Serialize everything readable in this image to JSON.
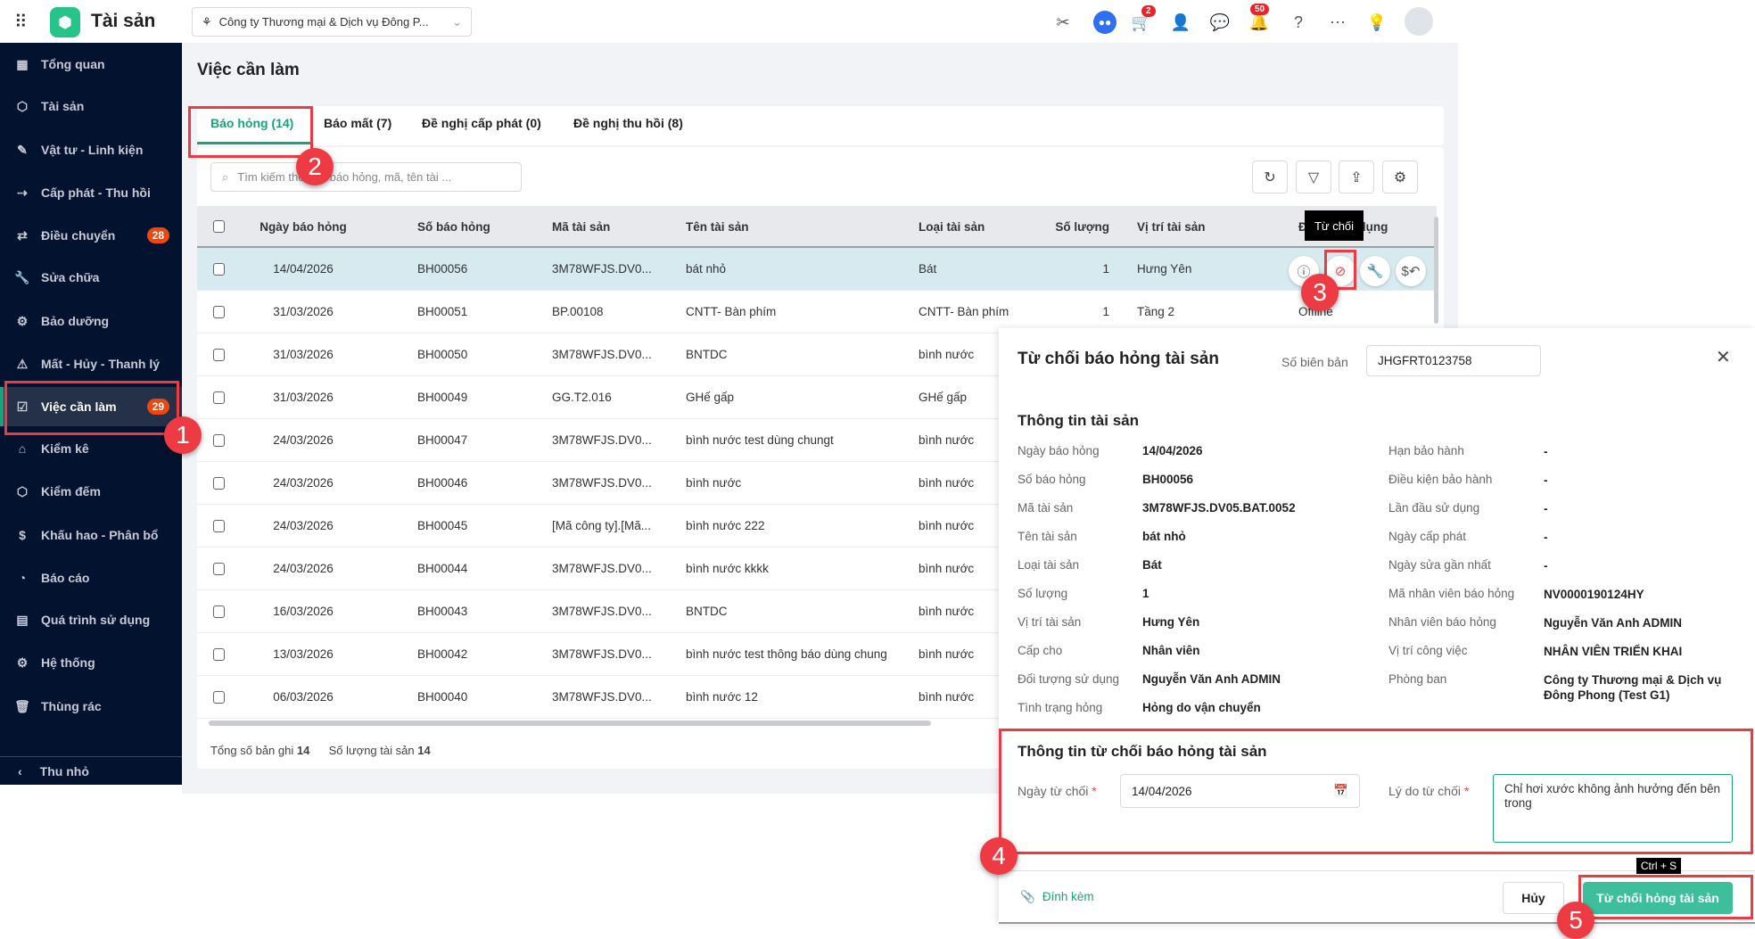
{
  "header": {
    "app_title": "Tài sản",
    "company_select": "Công ty Thương mại & Dịch vụ Đông P...",
    "cart_badge": "2",
    "notification_badge": "50"
  },
  "sidebar": {
    "items": [
      {
        "label": "Tổng quan",
        "icon": "grid-icon"
      },
      {
        "label": "Tài sản",
        "icon": "box-icon"
      },
      {
        "label": "Vật tư - Linh kiện",
        "icon": "pen-icon"
      },
      {
        "label": "Cấp phát - Thu hồi",
        "icon": "user-transfer-icon"
      },
      {
        "label": "Điều chuyển",
        "icon": "swap-icon",
        "badge": "28"
      },
      {
        "label": "Sửa chữa",
        "icon": "wrench-icon"
      },
      {
        "label": "Bảo dưỡng",
        "icon": "maintenance-icon"
      },
      {
        "label": "Mất - Hủy - Thanh lý",
        "icon": "warning-icon"
      },
      {
        "label": "Việc cần làm",
        "icon": "checkbox-icon",
        "badge": "29"
      },
      {
        "label": "Kiểm kê",
        "icon": "inbox-icon"
      },
      {
        "label": "Kiểm đếm",
        "icon": "box-icon"
      },
      {
        "label": "Khấu hao - Phân bổ",
        "icon": "dollar-icon"
      },
      {
        "label": "Báo cáo",
        "icon": "pie-icon"
      },
      {
        "label": "Quá trình sử dụng",
        "icon": "document-icon"
      },
      {
        "label": "Hệ thống",
        "icon": "gear-icon"
      },
      {
        "label": "Thùng rác",
        "icon": "trash-icon"
      }
    ],
    "collapse_label": "Thu nhỏ"
  },
  "main": {
    "page_title": "Việc cần làm",
    "tabs": [
      "Báo hỏng (14)",
      "Báo mất (7)",
      "Đề nghị cấp phát (0)",
      "Đề nghị thu hồi (8)"
    ],
    "search_placeholder": "Tìm kiếm theo số báo hỏng, mã, tên tài ...",
    "columns": [
      "Ngày báo hỏng",
      "Số báo hỏng",
      "Mã tài sản",
      "Tên tài sản",
      "Loại tài sản",
      "Số lượng",
      "Vị trí tài sản",
      "Đơn vị sử dụng"
    ],
    "rows": [
      [
        "14/04/2026",
        "BH00056",
        "3M78WFJS.DV0...",
        "bát nhỏ",
        "Bát",
        "1",
        "Hưng Yên",
        ""
      ],
      [
        "31/03/2026",
        "BH00051",
        "BP.00108",
        "CNTT- Bàn phím",
        "CNTT- Bàn phím",
        "1",
        "Tầng 2",
        "Offline"
      ],
      [
        "31/03/2026",
        "BH00050",
        "3M78WFJS.DV0...",
        "BNTDC",
        "bình nước",
        "",
        "",
        ""
      ],
      [
        "31/03/2026",
        "BH00049",
        "GG.T2.016",
        "GHế gấp",
        "GHế gấp",
        "",
        "",
        ""
      ],
      [
        "24/03/2026",
        "BH00047",
        "3M78WFJS.DV0...",
        "bình nước test dùng chungt",
        "bình nước",
        "",
        "",
        ""
      ],
      [
        "24/03/2026",
        "BH00046",
        "3M78WFJS.DV0...",
        "bình nước",
        "bình nước",
        "",
        "",
        ""
      ],
      [
        "24/03/2026",
        "BH00045",
        "[Mã công ty].[Mã...",
        "bình nước 222",
        "bình nước",
        "",
        "",
        ""
      ],
      [
        "24/03/2026",
        "BH00044",
        "3M78WFJS.DV0...",
        "bình nước kkkk",
        "bình nước",
        "",
        "",
        ""
      ],
      [
        "16/03/2026",
        "BH00043",
        "3M78WFJS.DV0...",
        "BNTDC",
        "bình nước",
        "",
        "",
        ""
      ],
      [
        "13/03/2026",
        "BH00042",
        "3M78WFJS.DV0...",
        "bình nước test thông báo dùng chung",
        "bình nước",
        "",
        "",
        ""
      ],
      [
        "06/03/2026",
        "BH00040",
        "3M78WFJS.DV0...",
        "bình nước 12",
        "bình nước",
        "",
        "",
        ""
      ]
    ],
    "footer": {
      "total_label": "Tổng số bản ghi",
      "total": "14",
      "qty_label": "Số lượng tài sản",
      "qty": "14"
    },
    "reject_tooltip": "Từ chối"
  },
  "panel": {
    "title": "Từ chối báo hỏng tài sản",
    "record_label": "Số biên bản",
    "record_value": "JHGFRT0123758",
    "info_title": "Thông tin tài sản",
    "left": [
      {
        "label": "Ngày báo hỏng",
        "value": "14/04/2026"
      },
      {
        "label": "Số báo hỏng",
        "value": "BH00056"
      },
      {
        "label": "Mã tài sản",
        "value": "3M78WFJS.DV05.BAT.0052"
      },
      {
        "label": "Tên tài sản",
        "value": "bát nhỏ"
      },
      {
        "label": "Loại tài sản",
        "value": "Bát"
      },
      {
        "label": "Số lượng",
        "value": "1"
      },
      {
        "label": "Vị trí tài sản",
        "value": "Hưng Yên"
      },
      {
        "label": "Cấp cho",
        "value": "Nhân viên"
      },
      {
        "label": "Đối tượng sử dụng",
        "value": "Nguyễn Văn Anh ADMIN"
      },
      {
        "label": "Tình trạng hỏng",
        "value": "Hỏng do vận chuyển"
      }
    ],
    "right": [
      {
        "label": "Hạn bảo hành",
        "value": "-"
      },
      {
        "label": "Điều kiện bảo hành",
        "value": "-"
      },
      {
        "label": "Lần đầu sử dụng",
        "value": "-"
      },
      {
        "label": "Ngày cấp phát",
        "value": "-"
      },
      {
        "label": "Ngày sửa gần nhất",
        "value": "-"
      },
      {
        "label": "Mã nhân viên báo hỏng",
        "value": "NV0000190124HY"
      },
      {
        "label": "Nhân viên báo hỏng",
        "value": "Nguyễn Văn Anh ADMIN"
      },
      {
        "label": "Vị trí công việc",
        "value": "NHÂN VIÊN TRIỂN KHAI"
      },
      {
        "label": "Phòng ban",
        "value": "Công ty Thương mại & Dịch vụ Đông Phong (Test G1)"
      }
    ],
    "reject_title": "Thông tin từ chối báo hỏng tài sản",
    "reject_date_label": "Ngày từ chối",
    "reject_date": "14/04/2026",
    "reason_label": "Lý do từ chối",
    "reason": "Chỉ hơi xước không ảnh hưởng đến bên trong",
    "required_mark": "*",
    "attach_label": "Đính kèm",
    "cancel_label": "Hủy",
    "submit_label": "Từ chối hỏng tài sản",
    "shortcut_tooltip": "Ctrl + S"
  },
  "markers": [
    "1",
    "2",
    "3",
    "4",
    "5"
  ],
  "colors": {
    "accent": "#1aa37a",
    "sidebar": "#02122f",
    "highlight": "#ee3a43",
    "primary_button": "#3cbf9a"
  }
}
